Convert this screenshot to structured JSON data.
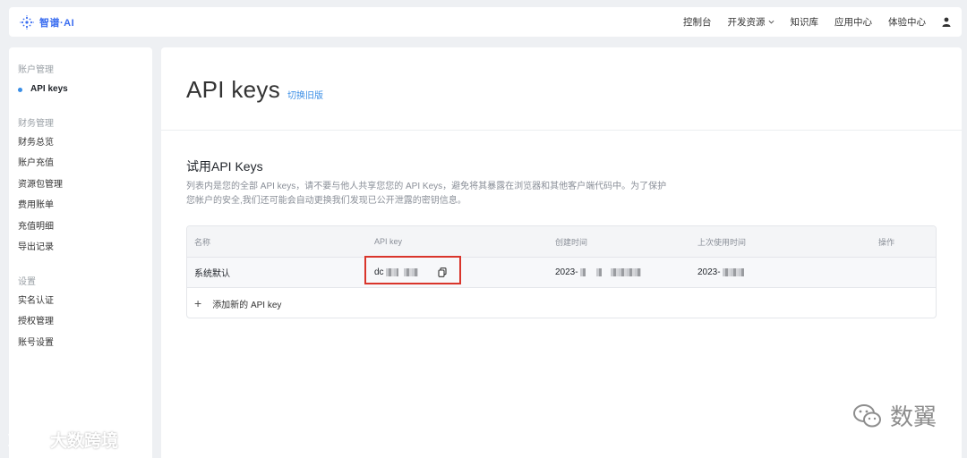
{
  "brand": {
    "name": "智谱·AI",
    "accent": "#3a6df0"
  },
  "nav": {
    "items": [
      "控制台",
      "开发资源",
      "知识库",
      "应用中心",
      "体验中心"
    ]
  },
  "sidebar": {
    "groups": [
      {
        "title": "账户管理",
        "items": [
          "API keys"
        ]
      },
      {
        "title": "财务管理",
        "items": [
          "财务总览",
          "账户充值",
          "资源包管理",
          "费用账单",
          "充值明细",
          "导出记录"
        ]
      },
      {
        "title": "设置",
        "items": [
          "实名认证",
          "授权管理",
          "账号设置"
        ]
      }
    ],
    "active": "API keys"
  },
  "page": {
    "title": "API keys",
    "switch_link": "切换旧版",
    "section_title": "试用API Keys",
    "description": "列表内是您的全部 API keys，请不要与他人共享您您的 API Keys，避免将其暴露在浏览器和其他客户端代码中。为了保护您帐户的安全,我们还可能会自动更换我们发现已公开泄露的密钥信息。"
  },
  "table": {
    "headers": [
      "名称",
      "API key",
      "创建时间",
      "上次使用时间",
      "操作"
    ],
    "rows": [
      {
        "name": "系统默认",
        "key_prefix": "dc",
        "created": "2023-",
        "last_used": "2023-"
      }
    ],
    "add_label": "添加新的 API key",
    "highlight_color": "#d9352b"
  },
  "watermarks": {
    "left": "大数跨境",
    "right": "数翼"
  }
}
